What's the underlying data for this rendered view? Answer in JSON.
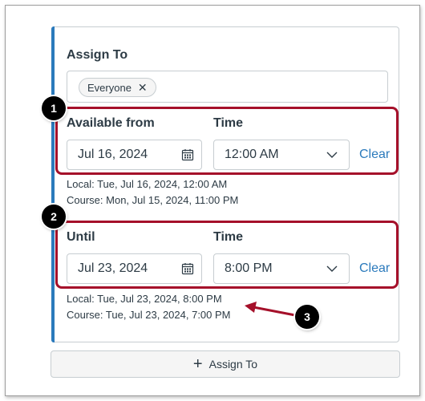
{
  "assign": {
    "heading": "Assign To",
    "pill_label": "Everyone",
    "pill_remove": "✕"
  },
  "available": {
    "label": "Available from",
    "time_label": "Time",
    "date_value": "Jul 16, 2024",
    "time_value": "12:00 AM",
    "clear_label": "Clear",
    "local_note": "Local: Tue, Jul 16, 2024, 12:00 AM",
    "course_note": "Course: Mon, Jul 15, 2024, 11:00 PM"
  },
  "until": {
    "label": "Until",
    "time_label": "Time",
    "date_value": "Jul 23, 2024",
    "time_value": "8:00 PM",
    "clear_label": "Clear",
    "local_note": "Local: Tue, Jul 23, 2024, 8:00 PM",
    "course_note": "Course: Tue, Jul 23, 2024, 7:00 PM"
  },
  "callouts": [
    "1",
    "2",
    "3"
  ],
  "add_button": {
    "icon": "plus-icon",
    "label": "Assign To"
  },
  "colors": {
    "accent": "#2b7abc",
    "highlight": "#a5102a",
    "text": "#2d3b45",
    "border": "#c7cdd1"
  }
}
